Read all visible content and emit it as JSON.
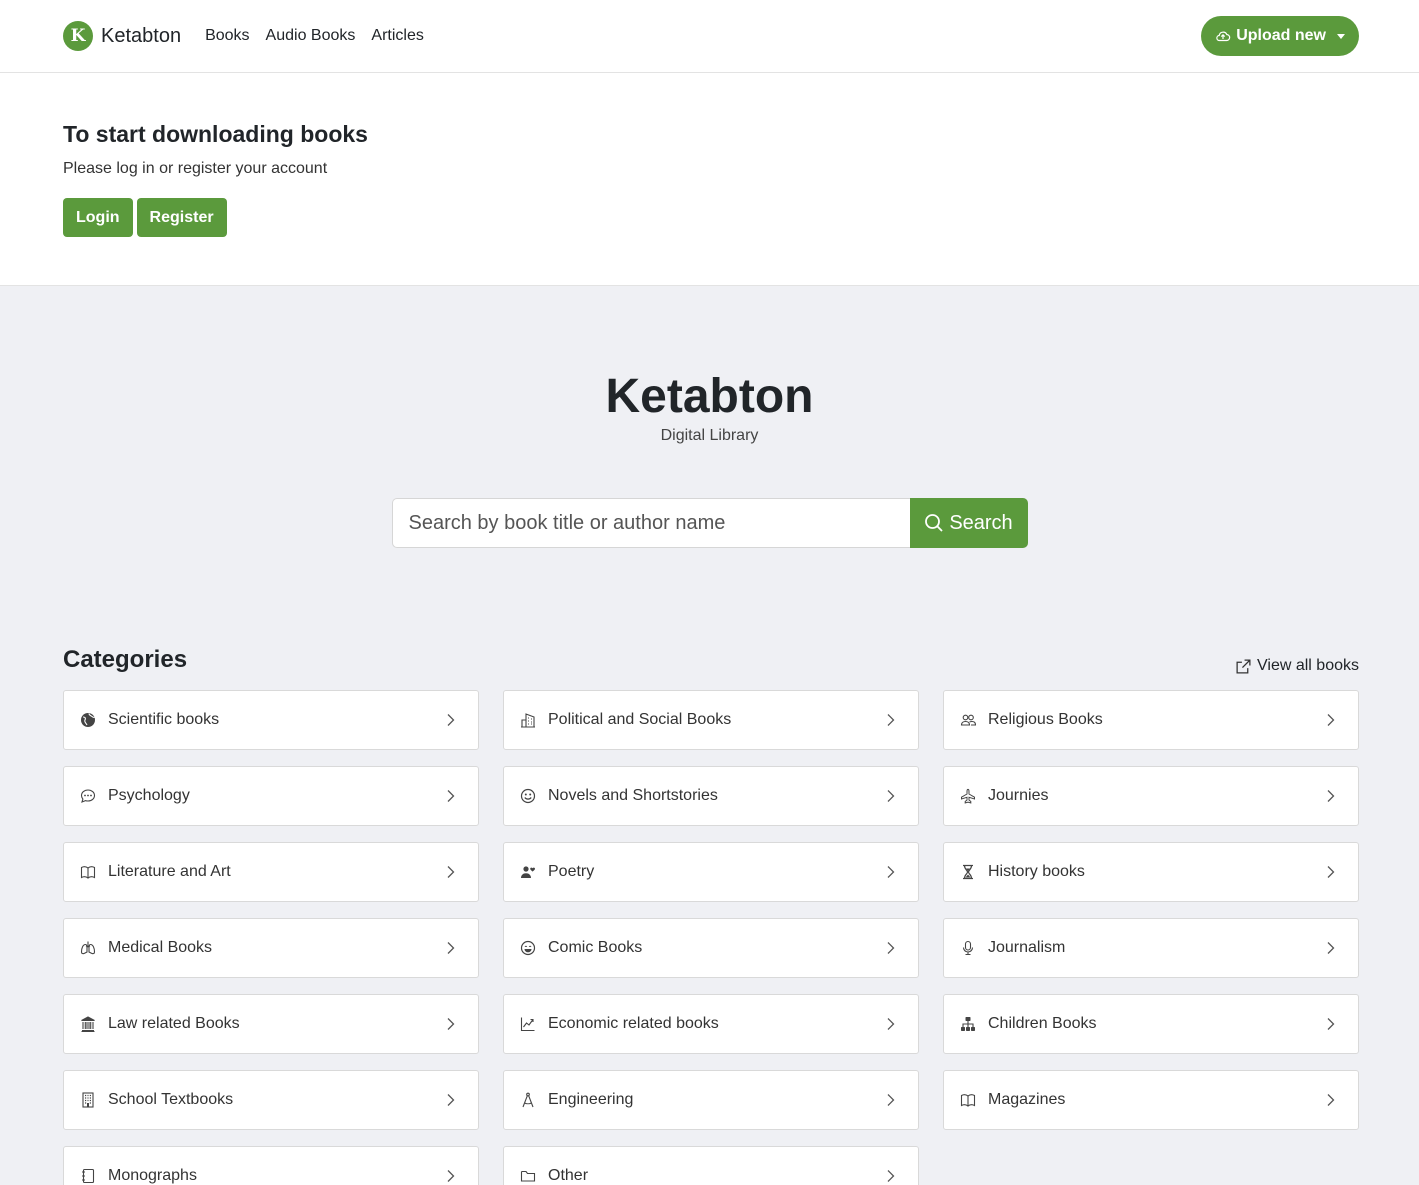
{
  "nav": {
    "logo_letter": "K",
    "brand": "Ketabton",
    "links": [
      "Books",
      "Audio Books",
      "Articles"
    ],
    "upload_label": "Upload new"
  },
  "login_panel": {
    "heading": "To start downloading books",
    "text": "Please log in or register your account",
    "login_label": "Login",
    "register_label": "Register"
  },
  "hero": {
    "title": "Ketabton",
    "subtitle": "Digital Library",
    "search_placeholder": "Search by book title or author name",
    "search_button": "Search"
  },
  "categories": {
    "heading": "Categories",
    "view_all": "View all books",
    "items": [
      {
        "label": "Scientific books",
        "icon": "globe-icon"
      },
      {
        "label": "Political and Social Books",
        "icon": "buildings-icon"
      },
      {
        "label": "Religious Books",
        "icon": "people-icon"
      },
      {
        "label": "Psychology",
        "icon": "chat-icon"
      },
      {
        "label": "Novels and Shortstories",
        "icon": "smile-icon"
      },
      {
        "label": "Journies",
        "icon": "airplane-icon"
      },
      {
        "label": "Literature and Art",
        "icon": "book-icon"
      },
      {
        "label": "Poetry",
        "icon": "person-heart-icon"
      },
      {
        "label": "History books",
        "icon": "hourglass-icon"
      },
      {
        "label": "Medical Books",
        "icon": "lungs-icon"
      },
      {
        "label": "Comic Books",
        "icon": "laugh-icon"
      },
      {
        "label": "Journalism",
        "icon": "mic-icon"
      },
      {
        "label": "Law related Books",
        "icon": "bank-icon"
      },
      {
        "label": "Economic related books",
        "icon": "graph-icon"
      },
      {
        "label": "Children Books",
        "icon": "diagram-icon"
      },
      {
        "label": "School Textbooks",
        "icon": "building-icon"
      },
      {
        "label": "Engineering",
        "icon": "compass-icon"
      },
      {
        "label": "Magazines",
        "icon": "book-icon"
      },
      {
        "label": "Monographs",
        "icon": "journal-icon"
      },
      {
        "label": "Other",
        "icon": "folder-icon"
      }
    ]
  },
  "colors": {
    "accent": "#5b9a3c",
    "hero_bg": "#eff0f4"
  }
}
